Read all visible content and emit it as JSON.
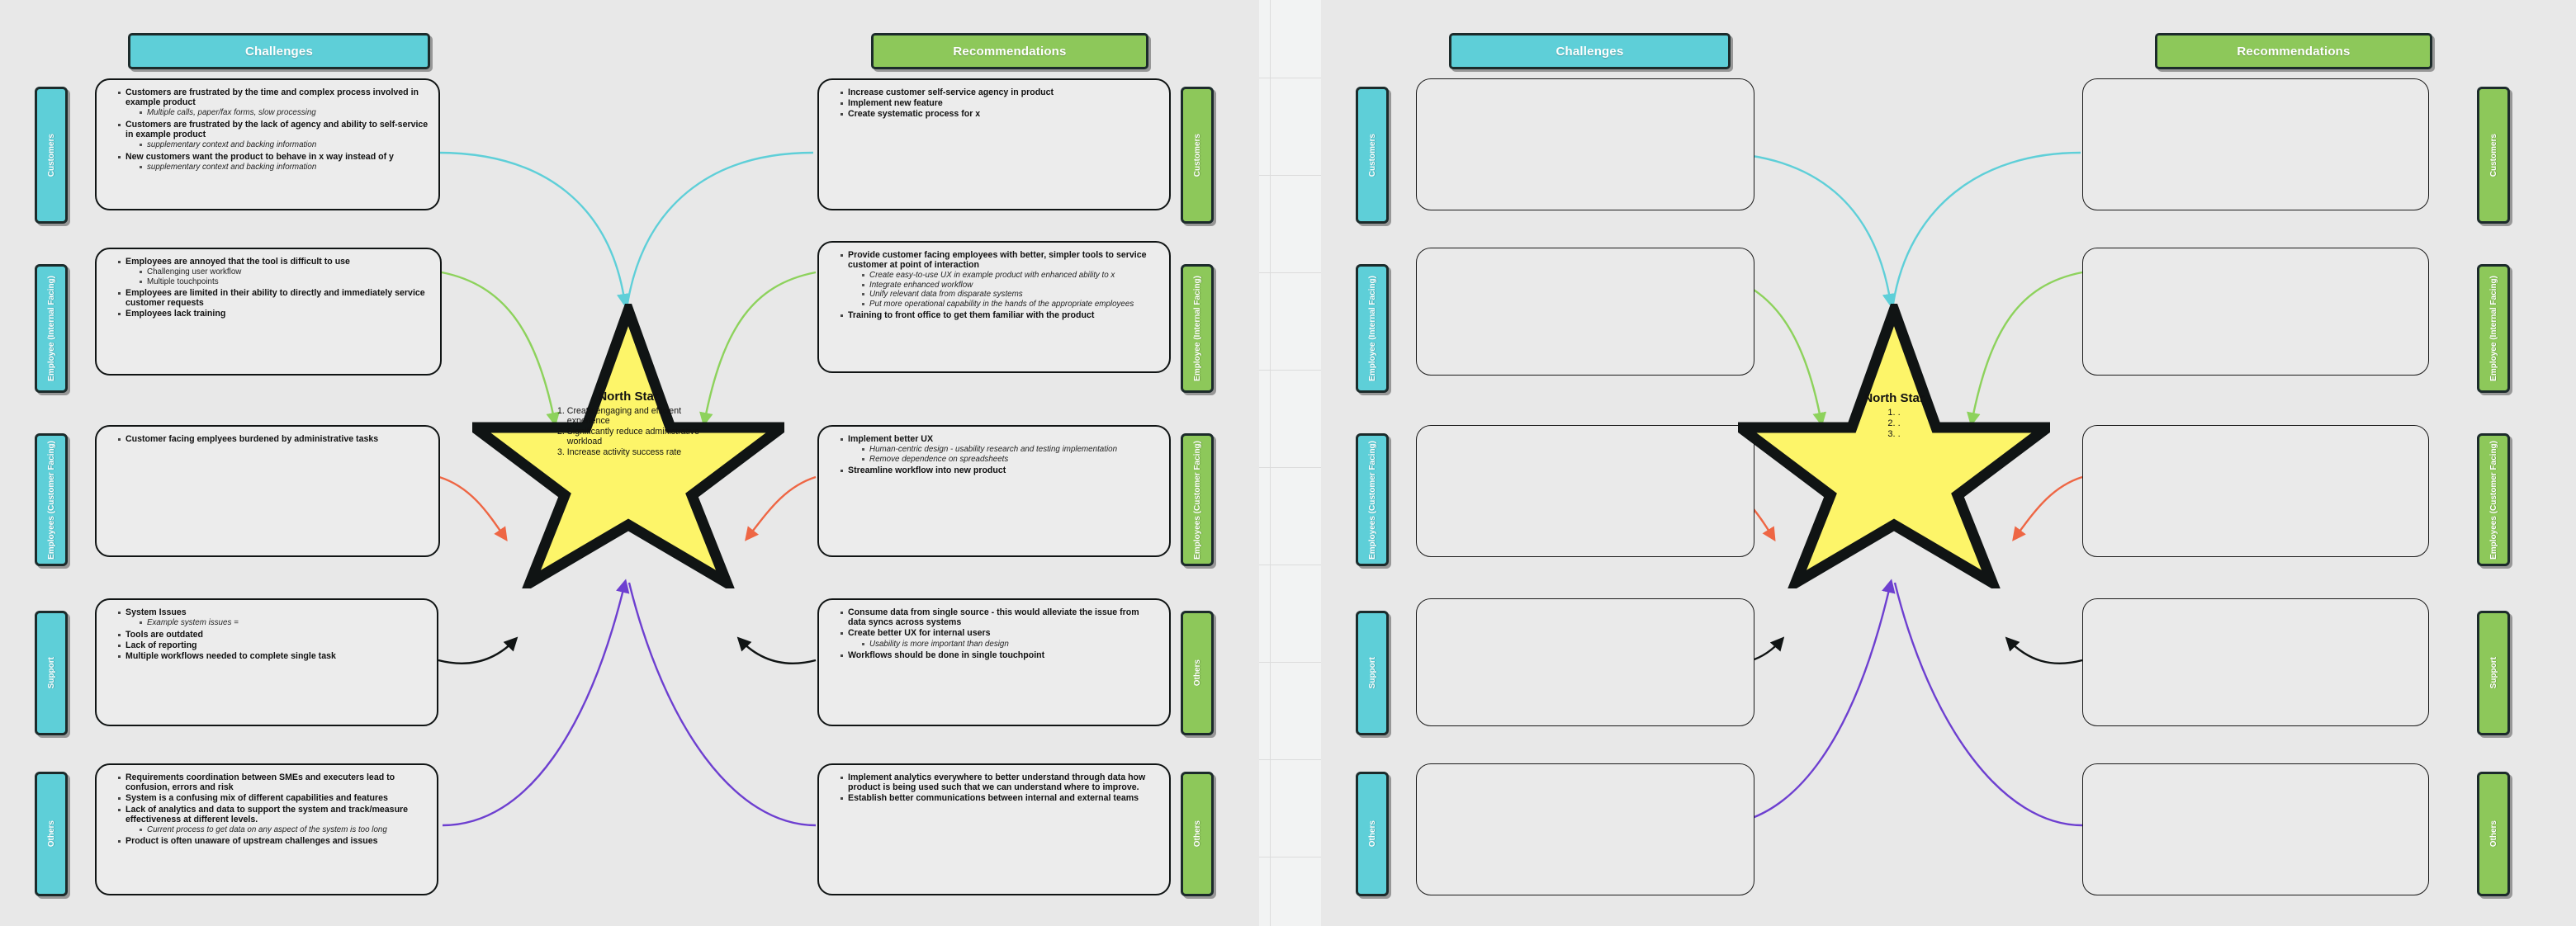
{
  "canvas": {
    "background": "#e8e8e8",
    "grid_background": "#f2f3f3",
    "teal": "#5ecfd8",
    "green": "#8dc85a",
    "star_fill": "#fdf569"
  },
  "headers": {
    "challenges": "Challenges",
    "recommendations": "Recommendations"
  },
  "row_labels": [
    "Customers",
    "Employee (Internal Facing)",
    "Employees (Customer Facing)",
    "Support",
    "Others"
  ],
  "star": {
    "title": "North Star",
    "items": [
      "1. Create engaging and efficient",
      "    experience",
      "2. Significantly reduce administrative",
      "    workload",
      "3. Increase activity success rate"
    ],
    "empty_items": [
      "1. .",
      "2. .",
      "3. ."
    ]
  },
  "left_panel": {
    "challenges": [
      {
        "row": "Customers",
        "bullets": [
          {
            "text": "Customers are frustrated by the time and complex process involved in example product",
            "sub": [
              "Multiple calls, paper/fax forms, slow processing"
            ]
          },
          {
            "text": "Customers are frustrated by the lack of agency and ability to self-service in example product",
            "sub": [
              "supplementary context and backing information"
            ]
          },
          {
            "text": "New customers want the product to behave in x way instead of y",
            "sub": [
              "supplementary context and backing information"
            ]
          }
        ]
      },
      {
        "row": "Employee (Internal Facing)",
        "bullets": [
          {
            "text": "Employees are annoyed that the tool is difficult to use",
            "sub": [
              "Challenging user workflow",
              "Multiple touchpoints"
            ],
            "sub_style": "plain"
          },
          {
            "text": "Employees are limited in their ability to directly and immediately service customer requests",
            "sub": []
          },
          {
            "text": "Employees lack training",
            "sub": []
          }
        ]
      },
      {
        "row": "Employees (Customer Facing)",
        "bullets": [
          {
            "text": "Customer facing emplyees burdened by administrative tasks",
            "sub": []
          }
        ]
      },
      {
        "row": "Support",
        "bullets": [
          {
            "text": "System Issues",
            "sub": [
              "Example system issues ="
            ]
          },
          {
            "text": "Tools are outdated",
            "sub": []
          },
          {
            "text": "Lack of reporting",
            "sub": []
          },
          {
            "text": "Multiple workflows needed to complete single task",
            "sub": []
          }
        ]
      },
      {
        "row": "Others",
        "bullets": [
          {
            "text": "Requirements coordination between SMEs and executers lead to confusion, errors and risk",
            "sub": []
          },
          {
            "text": "System is a confusing mix of different capabilities and features",
            "sub": []
          },
          {
            "text": "Lack of analytics and data to support the system and track/measure effectiveness at different levels.",
            "sub": [
              "Current process to get data on any aspect of the system is too long"
            ]
          },
          {
            "text": "Product is often unaware of upstream challenges and issues",
            "sub": []
          }
        ]
      }
    ],
    "recommendations": [
      {
        "row": "Customers",
        "bullets": [
          {
            "text": "Increase customer self-service agency in product",
            "sub": []
          },
          {
            "text": "Implement new feature",
            "sub": []
          },
          {
            "text": "Create systematic process for x",
            "sub": []
          }
        ]
      },
      {
        "row": "Employee (Internal Facing)",
        "bullets": [
          {
            "text": "Provide customer facing employees with better, simpler tools to service customer at point of interaction",
            "sub": [
              "Create easy-to-use UX in example product with enhanced ability to x",
              "Integrate enhanced workflow",
              "Unify relevant data from disparate systems",
              "Put more operational capability in the hands of the appropriate employees"
            ]
          },
          {
            "text": "Training to front office to get them familiar with the product",
            "sub": []
          }
        ]
      },
      {
        "row": "Employees (Customer Facing)",
        "bullets": [
          {
            "text": "Implement better UX",
            "sub": [
              "Human-centric design - usability research and testing implementation",
              "Remove dependence on spreadsheets"
            ]
          },
          {
            "text": "Streamline workflow into new product",
            "sub": []
          }
        ]
      },
      {
        "row": "Support",
        "bullets": [
          {
            "text": "Consume data from single source - this would alleviate the issue from data syncs across systems",
            "sub": []
          },
          {
            "text": "Create better UX for internal users",
            "sub": [
              "Usability is more important than design"
            ]
          },
          {
            "text": "Workflows should be done in single touchpoint",
            "sub": []
          }
        ]
      },
      {
        "row": "Others",
        "bullets": [
          {
            "text": "Implement analytics everywhere to better understand through data how product is being used such that we can understand where to improve.",
            "sub": []
          },
          {
            "text": "Establish better communications between internal and external teams",
            "sub": []
          }
        ]
      }
    ]
  },
  "right_panel": {
    "challenges": [
      {
        "row": "Customers",
        "bullets": []
      },
      {
        "row": "Employee (Internal Facing)",
        "bullets": []
      },
      {
        "row": "Employees (Customer Facing)",
        "bullets": []
      },
      {
        "row": "Support",
        "bullets": []
      },
      {
        "row": "Others",
        "bullets": []
      }
    ],
    "recommendations": [
      {
        "row": "Customers",
        "bullets": []
      },
      {
        "row": "Employee (Internal Facing)",
        "bullets": []
      },
      {
        "row": "Employees (Customer Facing)",
        "bullets": []
      },
      {
        "row": "Support",
        "bullets": []
      },
      {
        "row": "Others",
        "bullets": []
      }
    ]
  },
  "connector_colors": {
    "row1": "#5ecfd8",
    "row2": "#8dd25c",
    "row3": "#ee6644",
    "row4": "#101414",
    "row5": "#6d3fd0"
  }
}
